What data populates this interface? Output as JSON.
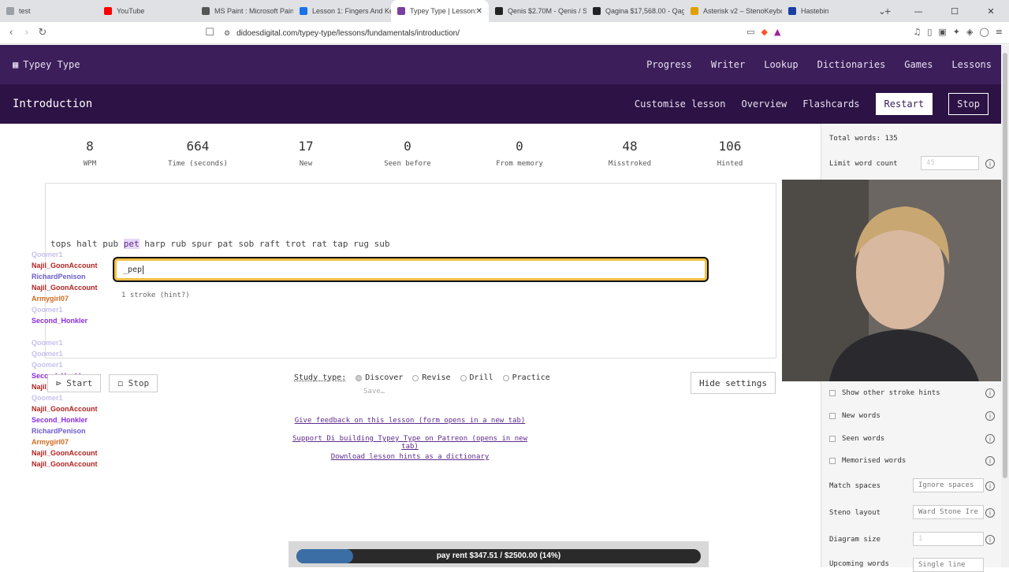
{
  "browser": {
    "tabs": [
      {
        "title": "test",
        "color": "#9aa0a6"
      },
      {
        "title": "YouTube",
        "color": "#ff0000"
      },
      {
        "title": "MS Paint : Microsoft Paint",
        "color": "#555555"
      },
      {
        "title": "Lesson 1: Fingers And Key",
        "color": "#1a73e8"
      },
      {
        "title": "Typey Type | Lesson:",
        "color": "#7b3fa0"
      },
      {
        "title": "Qenis $2.70M - Qenis / S",
        "color": "#222222"
      },
      {
        "title": "Qagina $17,568.00 - Qag",
        "color": "#222222"
      },
      {
        "title": "Asterisk v2 – StenoKeybo",
        "color": "#e0a000"
      },
      {
        "title": "Hastebin",
        "color": "#1a3fa0"
      }
    ],
    "active_tab": 4,
    "new_tab": "+",
    "url": "didoesdigital.com/typey-type/lessons/fundamentals/introduction/"
  },
  "app": {
    "name": "Typey Type",
    "nav": [
      "Progress",
      "Writer",
      "Lookup",
      "Dictionaries",
      "Games",
      "Lessons"
    ],
    "lesson_title": "Introduction",
    "lesson_links": [
      "Customise lesson",
      "Overview",
      "Flashcards"
    ],
    "restart_label": "Restart",
    "stop_label": "Stop"
  },
  "stats": [
    {
      "value": "8",
      "label": "WPM"
    },
    {
      "value": "664",
      "label": "Time (seconds)"
    },
    {
      "value": "17",
      "label": "New"
    },
    {
      "value": "0",
      "label": "Seen before"
    },
    {
      "value": "0",
      "label": "From memory"
    },
    {
      "value": "48",
      "label": "Misstroked"
    },
    {
      "value": "106",
      "label": "Hinted"
    }
  ],
  "material": {
    "before": "tops halt pub ",
    "current": "pet",
    "after": " harp rub spur pat sob raft trot rat tap rug sub",
    "typed": "_pep",
    "hint": "1 stroke (hint?)"
  },
  "chat": [
    {
      "user": "Qoomer1",
      "color": "#5a4fcf",
      "msg": "",
      "faded": true
    },
    {
      "user": "Najil_GoonAccount",
      "color": "#b22222",
      "msg": "",
      "faded": false
    },
    {
      "user": "RichardPenison",
      "color": "#6a5acd",
      "msg": "",
      "faded": false
    },
    {
      "user": "Najil_GoonAccount",
      "color": "#b22222",
      "msg": "",
      "faded": false
    },
    {
      "user": "Armygirl07",
      "color": "#d2691e",
      "msg": "",
      "faded": false
    },
    {
      "user": "Qoomer1",
      "color": "#5a4fcf",
      "msg": "",
      "faded": true
    },
    {
      "user": "Second_Honkler",
      "color": "#8a2be2",
      "msg": "",
      "faded": false
    },
    {
      "user": "",
      "color": "#999999",
      "msg": "",
      "faded": true
    },
    {
      "user": "Qoomer1",
      "color": "#5a4fcf",
      "msg": "",
      "faded": true
    },
    {
      "user": "Qoomer1",
      "color": "#5a4fcf",
      "msg": "",
      "faded": true
    },
    {
      "user": "Qoomer1",
      "color": "#5a4fcf",
      "msg": "",
      "faded": true
    },
    {
      "user": "Second_Honkler",
      "color": "#8a2be2",
      "msg": "",
      "faded": false
    },
    {
      "user": "Najil_GoonAccount",
      "color": "#b22222",
      "msg": "",
      "faded": false
    },
    {
      "user": "Qoomer1",
      "color": "#5a4fcf",
      "msg": "",
      "faded": true
    },
    {
      "user": "Najil_GoonAccount",
      "color": "#b22222",
      "msg": "",
      "faded": false
    },
    {
      "user": "Second_Honkler",
      "color": "#8a2be2",
      "msg": "",
      "faded": false
    },
    {
      "user": "RichardPenison",
      "color": "#6a5acd",
      "msg": "",
      "faded": false
    },
    {
      "user": "Armygirl07",
      "color": "#d2691e",
      "msg": "",
      "faded": false
    },
    {
      "user": "Najil_GoonAccount",
      "color": "#b22222",
      "msg": "",
      "faded": false
    },
    {
      "user": "Najil_GoonAccount",
      "color": "#b22222",
      "msg": "",
      "faded": false
    }
  ],
  "controls": {
    "start": "Start",
    "stop": "Stop"
  },
  "study": {
    "label": "Study type:",
    "options": [
      "Discover",
      "Revise",
      "Drill",
      "Practice"
    ],
    "selected": 0,
    "save": "Save…"
  },
  "hide_settings": "Hide settings",
  "footer_links": [
    "Give feedback on this lesson (form opens in a new tab)",
    "Support Di building Typey Type on Patreon (opens in new tab)",
    "Download lesson hints as a dictionary"
  ],
  "settings": {
    "total_words": "Total words: 135",
    "limit_label": "Limit word count",
    "limit_value": "45",
    "checks": [
      "Show other stroke hints",
      "New words",
      "Seen words",
      "Memorised words"
    ],
    "match_spaces": {
      "label": "Match spaces",
      "value": "Ignore spaces"
    },
    "steno_layout": {
      "label": "Steno layout",
      "value": "Ward Stone Ire"
    },
    "diagram_size": {
      "label": "Diagram size",
      "value": "1"
    },
    "upcoming": {
      "label": "Upcoming words",
      "value": "Single line"
    }
  },
  "goal": {
    "text": "pay rent $347.51 / $2500.00 (14%)",
    "progress": 0.14,
    "fill_color": "#3a6ea5"
  }
}
